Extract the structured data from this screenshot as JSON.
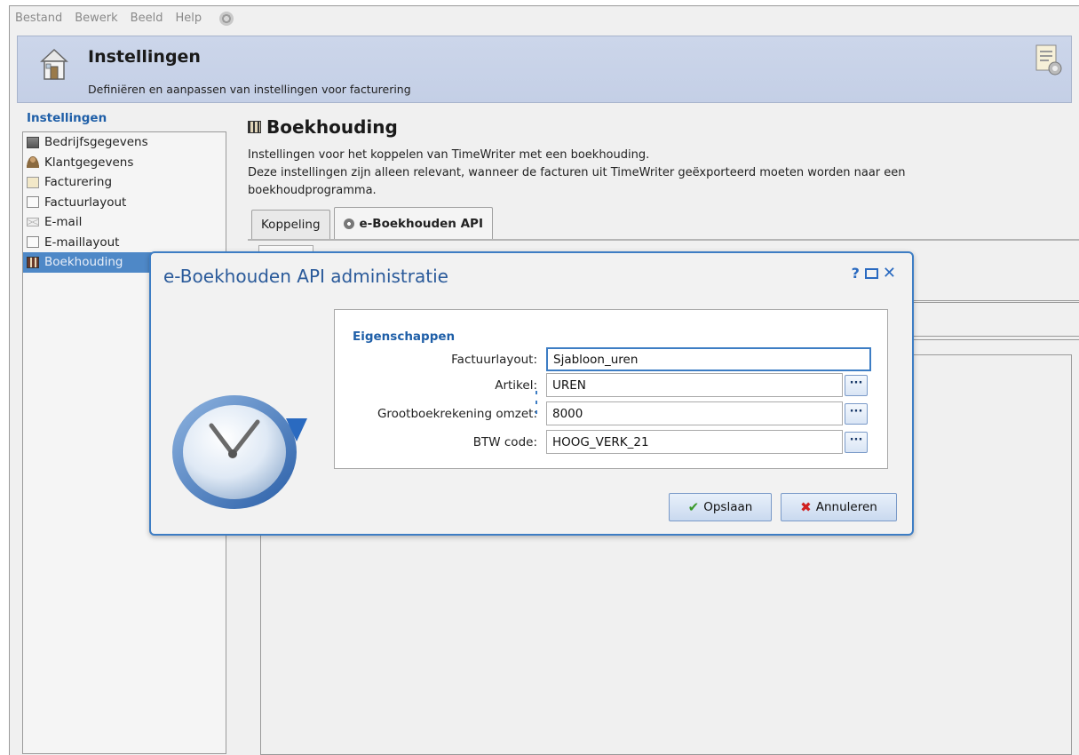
{
  "menubar": {
    "items": [
      "Bestand",
      "Bewerk",
      "Beeld",
      "Help"
    ]
  },
  "banner": {
    "title": "Instellingen",
    "subtitle": "Definiëren en aanpassen van instellingen voor facturering"
  },
  "sidebar": {
    "title": "Instellingen",
    "items": [
      {
        "label": "Bedrijfsgegevens",
        "icon": "building-icon"
      },
      {
        "label": "Klantgegevens",
        "icon": "person-icon"
      },
      {
        "label": "Facturering",
        "icon": "invoice-gear-icon"
      },
      {
        "label": "Factuurlayout",
        "icon": "page-layout-icon"
      },
      {
        "label": "E-mail",
        "icon": "envelope-icon"
      },
      {
        "label": "E-maillayout",
        "icon": "page-layout-icon"
      },
      {
        "label": "Boekhouding",
        "icon": "ledger-icon",
        "active": true
      }
    ]
  },
  "section": {
    "title": "Boekhouding",
    "description": "Instellingen voor het koppelen van TimeWriter met een boekhouding.\nDeze instellingen zijn alleen relevant, wanneer de facturen uit TimeWriter geëxporteerd moeten worden naar een boekhoudprogramma."
  },
  "tabs": [
    {
      "label": "Koppeling",
      "active": false
    },
    {
      "label": "e-Boekhouden API",
      "active": true
    }
  ],
  "dialog": {
    "title": "e-Boekhouden API administratie",
    "help": "?",
    "close": "✕",
    "group_title": "Eigenschappen",
    "fields": {
      "factuurlayout": {
        "label": "Factuurlayout:",
        "value": "Sjabloon_uren"
      },
      "artikel": {
        "label": "Artikel:",
        "value": "UREN"
      },
      "grootboek": {
        "label": "Grootboekrekening omzet:",
        "value": "8000"
      },
      "btw": {
        "label": "BTW code:",
        "value": "HOOG_VERK_21"
      }
    },
    "browse": "···",
    "save_label": "Opslaan",
    "cancel_label": "Annuleren"
  },
  "colors": {
    "accent": "#3d7dc4",
    "heading_blue": "#1f5fa8",
    "active_item": "#4e88c7",
    "banner": "#c8d2e8"
  }
}
